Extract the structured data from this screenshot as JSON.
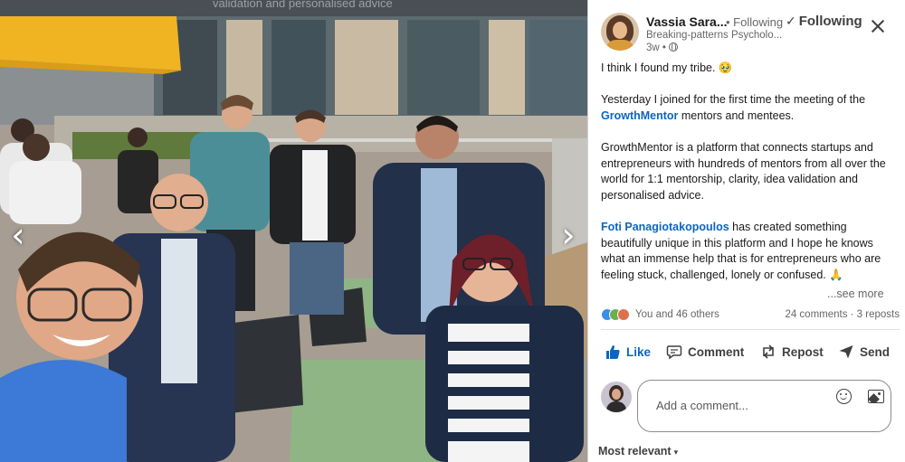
{
  "photo": {
    "background_text": "validation and personalised advice",
    "prev_arrow": "‹",
    "next_arrow": "›"
  },
  "post": {
    "author": {
      "name": "Vassia Sara...",
      "follow_status": "• Following",
      "headline": "Breaking-patterns Psycholo...",
      "time": "3w •",
      "visibility_icon": "globe-icon"
    },
    "following_button": "Following",
    "following_check": "✓",
    "text": {
      "line1": "I think I found my tribe. 🥹",
      "p2_pre": "Yesterday I joined for the first time the meeting of the ",
      "p2_mention": "GrowthMentor",
      "p2_post": " mentors and mentees.",
      "p3": "GrowthMentor is a platform that connects startups and entrepreneurs with hundreds of mentors from all over the world for 1:1 mentorship, clarity, idea validation and personalised advice.",
      "p4_mention": "Foti Panagiotakopoulos",
      "p4_post": " has created something beautifully unique in this platform and I hope he knows what an immense help that is for entrepreneurs who are feeling stuck, challenged, lonely or confused. 🙏"
    },
    "see_more": "...see more",
    "reactions_text": "You and 46 others",
    "counts": "24 comments · 3 reposts",
    "actions": {
      "like": "Like",
      "comment": "Comment",
      "repost": "Repost",
      "send": "Send"
    },
    "comment_placeholder": "Add a comment...",
    "sort_label": "Most relevant",
    "sort_caret": "▾"
  },
  "colors": {
    "linkedin_blue": "#0a66c2",
    "text_dark": "#191919",
    "text_muted": "#666666"
  }
}
